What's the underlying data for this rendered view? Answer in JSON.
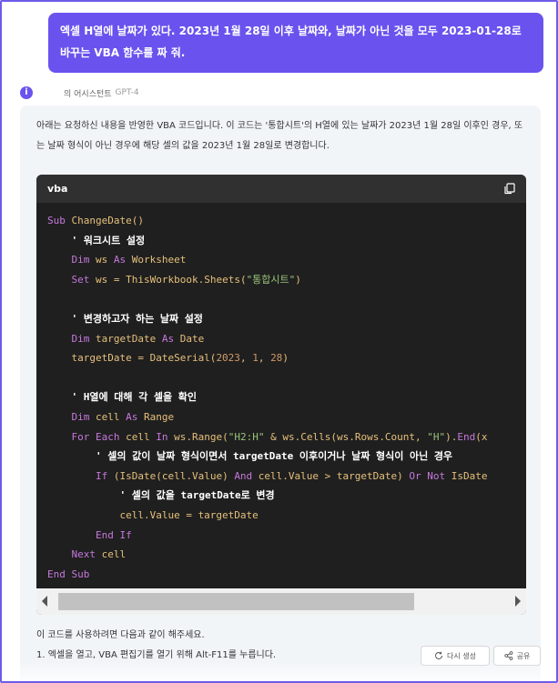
{
  "user_message": "엑셀 H열에 날짜가 있다. 2023년 1월 28일 이후 날짜와, 날짜가 아닌 것을 모두 2023-01-28로 바꾸는 VBA 함수를 짜 줘.",
  "assistant": {
    "icon_glyph": "i",
    "name": "의 어시스턴트",
    "model": "GPT-4"
  },
  "intro": "아래는 요청하신 내용을 반영한 VBA 코드입니다. 이 코드는 '통합시트'의 H열에 있는 날짜가 2023년 1월 28일 이후인 경우, 또는 날짜 형식이 아닌 경우에 해당 셀의 값을 2023년 1월 28일로 변경합니다.",
  "code": {
    "language": "vba",
    "copy_icon": "copy-icon",
    "lines": [
      "Sub ChangeDate()",
      "    ' 워크시트 설정",
      "    Dim ws As Worksheet",
      "    Set ws = ThisWorkbook.Sheets(\"통합시트\")",
      "",
      "    ' 변경하고자 하는 날짜 설정",
      "    Dim targetDate As Date",
      "    targetDate = DateSerial(2023, 1, 28)",
      "",
      "    ' H열에 대해 각 셀을 확인",
      "    Dim cell As Range",
      "    For Each cell In ws.Range(\"H2:H\" & ws.Cells(ws.Rows.Count, \"H\").End(x",
      "        ' 셀의 값이 날짜 형식이면서 targetDate 이후이거나 날짜 형식이 아닌 경우",
      "        If (IsDate(cell.Value) And cell.Value > targetDate) Or Not IsDate",
      "            ' 셀의 값을 targetDate로 변경",
      "            cell.Value = targetDate",
      "        End If",
      "    Next cell",
      "End Sub"
    ]
  },
  "outro": {
    "lead": "이 코드를 사용하려면 다음과 같이 해주세요.",
    "steps": [
      "1. 엑셀을 열고, VBA 편집기를 열기 위해 Alt-F11를 누릅니다."
    ]
  },
  "actions": {
    "regenerate_label": "다시 생성",
    "share_label": "공유"
  },
  "colors": {
    "accent": "#6a52ee",
    "frame": "#6d5ce8",
    "code_bg": "#1f1f1f",
    "code_header_bg": "#303030"
  }
}
